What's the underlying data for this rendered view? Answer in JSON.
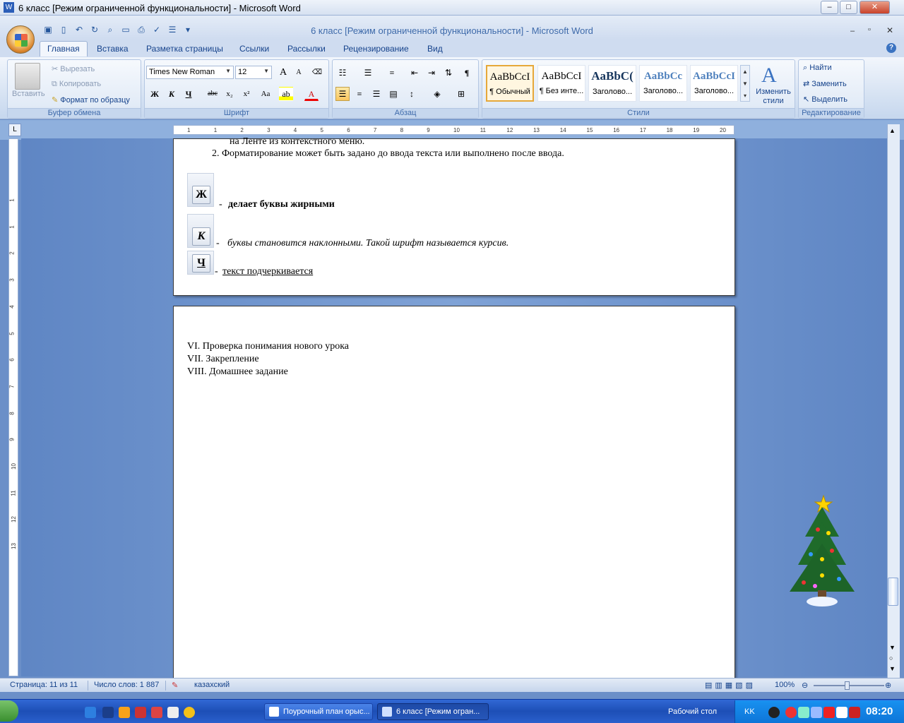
{
  "window": {
    "outer_title": "6 класс [Режим ограниченной функциональности] - Microsoft Word",
    "doc_title": "6 класс [Режим ограниченной функциональности] - Microsoft Word",
    "minimize": "–",
    "maximize": "□",
    "close": "✕"
  },
  "tabs": [
    "Главная",
    "Вставка",
    "Разметка страницы",
    "Ссылки",
    "Рассылки",
    "Рецензирование",
    "Вид"
  ],
  "ribbon": {
    "clipboard": {
      "paste": "Вставить",
      "cut": "Вырезать",
      "copy": "Копировать",
      "format_painter": "Формат по образцу",
      "label": "Буфер обмена"
    },
    "font": {
      "name": "Times New Roman",
      "size": "12",
      "bold": "Ж",
      "italic": "К",
      "underline": "Ч",
      "strike": "abc",
      "sub": "x₂",
      "sup": "x²",
      "case": "Aa",
      "grow": "A",
      "shrink": "A",
      "label": "Шрифт"
    },
    "paragraph": {
      "label": "Абзац",
      "pilcrow": "¶"
    },
    "styles": {
      "items": [
        {
          "sample": "AaBbCcI",
          "name": "¶ Обычный"
        },
        {
          "sample": "AaBbCcI",
          "name": "¶ Без инте..."
        },
        {
          "sample": "AaBbC(",
          "name": "Заголово..."
        },
        {
          "sample": "AaBbCc",
          "name": "Заголово..."
        },
        {
          "sample": "AaBbCcI",
          "name": "Заголово..."
        }
      ],
      "change": "Изменить стили",
      "label": "Стили"
    },
    "editing": {
      "find": "Найти",
      "replace": "Заменить",
      "select": "Выделить",
      "label": "Редактирование"
    }
  },
  "ruler": {
    "numbers": [
      "1",
      "1",
      "2",
      "3",
      "4",
      "5",
      "6",
      "7",
      "8",
      "9",
      "10",
      "11",
      "12",
      "13",
      "14",
      "15",
      "16",
      "17",
      "18",
      "19",
      "20"
    ],
    "vnumbers": [
      "1",
      "1",
      "2",
      "3",
      "4",
      "5",
      "6",
      "7",
      "8",
      "9",
      "10",
      "11",
      "12",
      "13"
    ]
  },
  "page1": {
    "line_top": "на Ленте   из контекстного  меню.",
    "item2": "2. Форматирование   может быть  задано   до ввода   текста или  выполнено после  ввода.",
    "bold_glyph": "Ж",
    "bold_text": "делает  буквы  жирными",
    "italic_glyph": "К",
    "italic_text": "буквы становится  наклонными. Такой шрифт называется  курсив.",
    "underline_glyph": "Ч",
    "underline_text": "текст подчеркивается",
    "dash": "-"
  },
  "page2": {
    "line1": "VI.  Проверка понимания нового урока",
    "line2": "VII. Закрепление",
    "line3": "VIII. Домашнее задание"
  },
  "status": {
    "page": "Страница: 11 из 11",
    "words": "Число слов: 1 887",
    "language": "казахский",
    "zoom": "100%"
  },
  "taskbar": {
    "tasks": [
      {
        "label": "Поурочный план орыс..."
      },
      {
        "label": "6 класс [Режим огран..."
      }
    ],
    "desktop": "Рабочий стол",
    "lang": "KK",
    "time": "08:20"
  }
}
